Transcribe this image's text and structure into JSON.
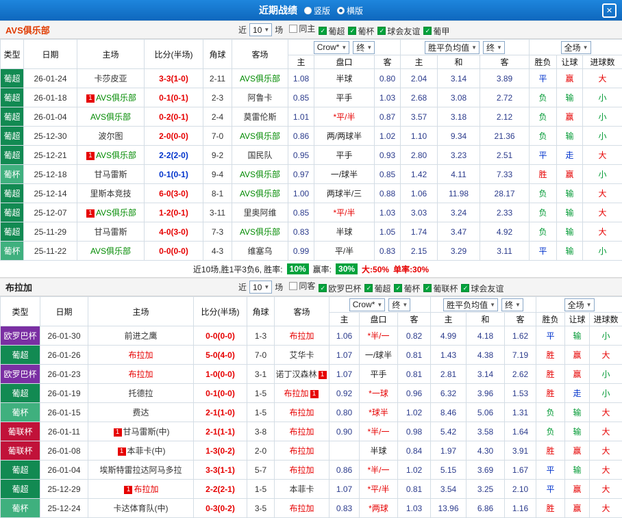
{
  "topbar": {
    "title": "近期战绩",
    "radios": [
      {
        "label": "竖版",
        "checked": false
      },
      {
        "label": "横版",
        "checked": true
      }
    ],
    "close": "✕"
  },
  "labels": {
    "near": "近",
    "games": "场"
  },
  "columns": [
    "类型",
    "日期",
    "主场",
    "比分(半场)",
    "角球",
    "客场",
    "主",
    "盘口",
    "客",
    "主",
    "和",
    "客",
    "胜负",
    "让球",
    "进球数"
  ],
  "type_colors": {
    "葡超": "#128a52",
    "葡杯": "#3fb07e",
    "欧罗巴杯": "#7b2fa3",
    "葡联杯": "#c11239",
    "葡甲": "#128a52"
  },
  "sections": [
    {
      "team": "AVS俱乐部",
      "team_color": "#e03c00",
      "focus_color": "#008a00",
      "count": "10",
      "checks": [
        {
          "label": "同主",
          "on": false
        },
        {
          "label": "葡超",
          "on": true
        },
        {
          "label": "葡杯",
          "on": true
        },
        {
          "label": "球会友谊",
          "on": true
        },
        {
          "label": "葡甲",
          "on": true
        }
      ],
      "dropdowns": {
        "company": "Crow*",
        "final_a": "终",
        "avg": "胜平负均值",
        "final_b": "终",
        "scope": "全场"
      },
      "rows": [
        {
          "type": "葡超",
          "date": "26-01-24",
          "home": "卡莎皮亚",
          "score": "3-3(1-0)",
          "corners": "2-11",
          "away": "AVS俱乐部",
          "away_focus": true,
          "odds_h": "1.08",
          "handicap": "半球",
          "odds_a": "0.80",
          "win": "2.04",
          "draw": "3.14",
          "lose": "3.89",
          "result": "平",
          "cover": "赢",
          "size": "大"
        },
        {
          "type": "葡超",
          "date": "26-01-18",
          "home": "AVS俱乐部",
          "home_focus": true,
          "home_card_b": "1",
          "score": "0-1(0-1)",
          "corners": "2-3",
          "away": "阿鲁卡",
          "odds_h": "0.85",
          "handicap": "平手",
          "odds_a": "1.03",
          "win": "2.68",
          "draw": "3.08",
          "lose": "2.72",
          "result": "负",
          "cover": "输",
          "size": "小"
        },
        {
          "type": "葡超",
          "date": "26-01-04",
          "home": "AVS俱乐部",
          "home_focus": true,
          "score": "0-2(0-1)",
          "corners": "2-4",
          "away": "莫雷伦斯",
          "odds_h": "1.01",
          "handicap": "*平/半",
          "odds_a": "0.87",
          "win": "3.57",
          "draw": "3.18",
          "lose": "2.12",
          "result": "负",
          "cover": "赢",
          "size": "小"
        },
        {
          "type": "葡超",
          "date": "25-12-30",
          "home": "波尔图",
          "score": "2-0(0-0)",
          "corners": "7-0",
          "away": "AVS俱乐部",
          "away_focus": true,
          "odds_h": "0.86",
          "handicap": "两/两球半",
          "odds_a": "1.02",
          "win": "1.10",
          "draw": "9.34",
          "lose": "21.36",
          "result": "负",
          "cover": "输",
          "size": "小"
        },
        {
          "type": "葡超",
          "date": "25-12-21",
          "home": "AVS俱乐部",
          "home_focus": true,
          "home_card_b": "1",
          "score": "2-2(2-0)",
          "score_blue": true,
          "corners": "9-2",
          "away": "国民队",
          "odds_h": "0.95",
          "handicap": "平手",
          "odds_a": "0.93",
          "win": "2.80",
          "draw": "3.23",
          "lose": "2.51",
          "result": "平",
          "cover": "走",
          "size": "大"
        },
        {
          "type": "葡杯",
          "date": "25-12-18",
          "home": "甘马雷斯",
          "score": "0-1(0-1)",
          "score_blue": true,
          "corners": "9-4",
          "away": "AVS俱乐部",
          "away_focus": true,
          "odds_h": "0.97",
          "handicap": "一/球半",
          "odds_a": "0.85",
          "win": "1.42",
          "draw": "4.11",
          "lose": "7.33",
          "result": "胜",
          "cover": "赢",
          "size": "小"
        },
        {
          "type": "葡超",
          "date": "25-12-14",
          "home": "里斯本竞技",
          "score": "6-0(3-0)",
          "corners": "8-1",
          "away": "AVS俱乐部",
          "away_focus": true,
          "odds_h": "1.00",
          "handicap": "两球半/三",
          "odds_a": "0.88",
          "win": "1.06",
          "draw": "11.98",
          "lose": "28.17",
          "result": "负",
          "cover": "输",
          "size": "大"
        },
        {
          "type": "葡超",
          "date": "25-12-07",
          "home": "AVS俱乐部",
          "home_focus": true,
          "home_card_b": "1",
          "score": "1-2(0-1)",
          "corners": "3-11",
          "away": "里奥阿维",
          "odds_h": "0.85",
          "handicap": "*平/半",
          "odds_a": "1.03",
          "win": "3.03",
          "draw": "3.24",
          "lose": "2.33",
          "result": "负",
          "cover": "输",
          "size": "大"
        },
        {
          "type": "葡超",
          "date": "25-11-29",
          "home": "甘马雷斯",
          "score": "4-0(3-0)",
          "corners": "7-3",
          "away": "AVS俱乐部",
          "away_focus": true,
          "odds_h": "0.83",
          "handicap": "半球",
          "odds_a": "1.05",
          "win": "1.74",
          "draw": "3.47",
          "lose": "4.92",
          "result": "负",
          "cover": "输",
          "size": "大"
        },
        {
          "type": "葡杯",
          "date": "25-11-22",
          "home": "AVS俱乐部",
          "home_focus": true,
          "score": "0-0(0-0)",
          "corners": "4-3",
          "away": "维塞乌",
          "odds_h": "0.99",
          "handicap": "平/半",
          "odds_a": "0.83",
          "win": "2.15",
          "draw": "3.29",
          "lose": "3.11",
          "result": "平",
          "cover": "输",
          "size": "小"
        }
      ],
      "summary": {
        "text_a": "近10场,胜1平3负6, 胜率:",
        "badge_a": "10%",
        "text_b": "赢率:",
        "badge_b": "30%",
        "text_c": "大:50%",
        "text_d": "单率:30%"
      }
    },
    {
      "team": "布拉加",
      "team_color": "#222222",
      "focus_color": "#e60000",
      "count": "10",
      "checks": [
        {
          "label": "同客",
          "on": false
        },
        {
          "label": "欧罗巴杯",
          "on": true
        },
        {
          "label": "葡超",
          "on": true
        },
        {
          "label": "葡杯",
          "on": true
        },
        {
          "label": "葡联杯",
          "on": true
        },
        {
          "label": "球会友谊",
          "on": true
        }
      ],
      "dropdowns": {
        "company": "Crow*",
        "final_a": "终",
        "avg": "胜平负均值",
        "final_b": "终",
        "scope": "全场"
      },
      "rows": [
        {
          "type": "欧罗巴杯",
          "date": "26-01-30",
          "home": "前进之鹰",
          "score": "0-0(0-0)",
          "corners": "1-3",
          "away": "布拉加",
          "away_focus": true,
          "odds_h": "1.06",
          "handicap": "*半/一",
          "odds_a": "0.82",
          "win": "4.99",
          "draw": "4.18",
          "lose": "1.62",
          "result": "平",
          "cover": "输",
          "size": "小"
        },
        {
          "type": "葡超",
          "date": "26-01-26",
          "home": "布拉加",
          "home_focus": true,
          "score": "5-0(4-0)",
          "corners": "7-0",
          "away": "艾华卡",
          "odds_h": "1.07",
          "handicap": "一/球半",
          "odds_a": "0.81",
          "win": "1.43",
          "draw": "4.38",
          "lose": "7.19",
          "result": "胜",
          "cover": "赢",
          "size": "大"
        },
        {
          "type": "欧罗巴杯",
          "date": "26-01-23",
          "home": "布拉加",
          "home_focus": true,
          "score": "1-0(0-0)",
          "corners": "3-1",
          "away": "诺丁汉森林",
          "away_card_a": "1",
          "odds_h": "1.07",
          "handicap": "平手",
          "odds_a": "0.81",
          "win": "2.81",
          "draw": "3.14",
          "lose": "2.62",
          "result": "胜",
          "cover": "赢",
          "size": "小"
        },
        {
          "type": "葡超",
          "date": "26-01-19",
          "home": "托德拉",
          "score": "0-1(0-0)",
          "corners": "1-5",
          "away": "布拉加",
          "away_focus": true,
          "away_card_a": "1",
          "odds_h": "0.92",
          "handicap": "*一球",
          "odds_a": "0.96",
          "win": "6.32",
          "draw": "3.96",
          "lose": "1.53",
          "result": "胜",
          "cover": "走",
          "size": "小"
        },
        {
          "type": "葡杯",
          "date": "26-01-15",
          "home": "费达",
          "score": "2-1(1-0)",
          "corners": "1-5",
          "away": "布拉加",
          "away_focus": true,
          "odds_h": "0.80",
          "handicap": "*球半",
          "odds_a": "1.02",
          "win": "8.46",
          "draw": "5.06",
          "lose": "1.31",
          "result": "负",
          "cover": "输",
          "size": "大"
        },
        {
          "type": "葡联杯",
          "date": "26-01-11",
          "home": "甘马雷斯(中)",
          "home_card_b": "1",
          "score": "2-1(1-1)",
          "corners": "3-8",
          "away": "布拉加",
          "away_focus": true,
          "odds_h": "0.90",
          "handicap": "*半/一",
          "odds_a": "0.98",
          "win": "5.42",
          "draw": "3.58",
          "lose": "1.64",
          "result": "负",
          "cover": "输",
          "size": "大"
        },
        {
          "type": "葡联杯",
          "date": "26-01-08",
          "home": "本菲卡(中)",
          "home_card_b": "1",
          "score": "1-3(0-2)",
          "corners": "2-0",
          "away": "布拉加",
          "away_focus": true,
          "odds_h": "",
          "handicap": "半球",
          "odds_a": "0.84",
          "win": "1.97",
          "draw": "4.30",
          "lose": "3.91",
          "result": "胜",
          "cover": "赢",
          "size": "大"
        },
        {
          "type": "葡超",
          "date": "26-01-04",
          "home": "埃斯特雷拉达阿马多拉",
          "score": "3-3(1-1)",
          "corners": "5-7",
          "away": "布拉加",
          "away_focus": true,
          "odds_h": "0.86",
          "handicap": "*半/一",
          "odds_a": "1.02",
          "win": "5.15",
          "draw": "3.69",
          "lose": "1.67",
          "result": "平",
          "cover": "输",
          "size": "大"
        },
        {
          "type": "葡超",
          "date": "25-12-29",
          "home": "布拉加",
          "home_focus": true,
          "home_card_b": "1",
          "score": "2-2(2-1)",
          "corners": "1-5",
          "away": "本菲卡",
          "odds_h": "1.07",
          "handicap": "*平/半",
          "odds_a": "0.81",
          "win": "3.54",
          "draw": "3.25",
          "lose": "2.10",
          "result": "平",
          "cover": "赢",
          "size": "大"
        },
        {
          "type": "葡杯",
          "date": "25-12-24",
          "home": "卡达体育队(中)",
          "score": "0-3(0-2)",
          "corners": "3-5",
          "away": "布拉加",
          "away_focus": true,
          "odds_h": "0.83",
          "handicap": "*两球",
          "odds_a": "1.03",
          "win": "13.96",
          "draw": "6.86",
          "lose": "1.16",
          "result": "胜",
          "cover": "赢",
          "size": "大"
        }
      ]
    }
  ]
}
